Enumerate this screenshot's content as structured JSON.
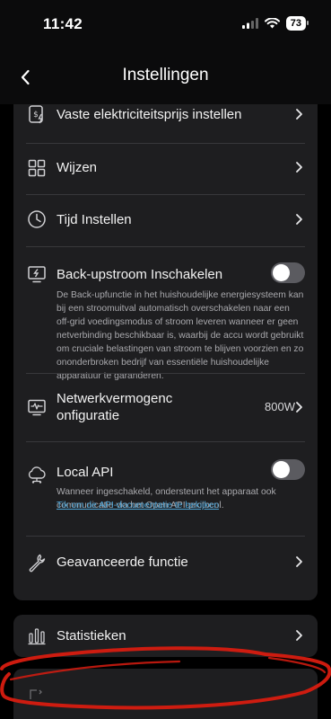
{
  "status_bar": {
    "time": "11:42",
    "battery": "73"
  },
  "nav": {
    "title": "Instellingen"
  },
  "rows": [
    {
      "label": "Vaste elektriciteitsprijs instellen",
      "icon": "price-tag-icon"
    },
    {
      "label": "Wijzen",
      "icon": "grid-icon"
    },
    {
      "label": "Tijd Instellen",
      "icon": "clock-icon"
    },
    {
      "label": "Back-upstroom Inschakelen",
      "icon": "backup-power-icon",
      "toggle_on": false,
      "description": "De Back-upfunctie in het huishoudelijke energiesysteem kan bij een stroomuitval automatisch overschakelen naar een off-grid voedingsmodus of stroom leveren wanneer er geen netverbinding beschikbaar is, waarbij de accu wordt gebruikt om cruciale belastingen van stroom te blijven voorzien en zo ononderbroken bedrijf van essentiële huishoudelijke apparatuur te garanderen."
    },
    {
      "label_line1": "Netwerkvermogenc",
      "label_line2": "onfiguratie",
      "icon": "network-power-icon",
      "value": "800W"
    },
    {
      "label": "Local API",
      "icon": "cloud-api-icon",
      "toggle_on": false,
      "description": "Wanneer ingeschakeld, ondersteunt het apparaat ook communicatie via het Open API-protocol.",
      "link": "Tik om de API-documentatie te bekijken"
    },
    {
      "label": "Geavanceerde functie",
      "icon": "wrench-icon"
    }
  ],
  "statistics": {
    "label": "Statistieken",
    "icon": "bar-chart-icon"
  },
  "annotation_color": "#d81c10"
}
